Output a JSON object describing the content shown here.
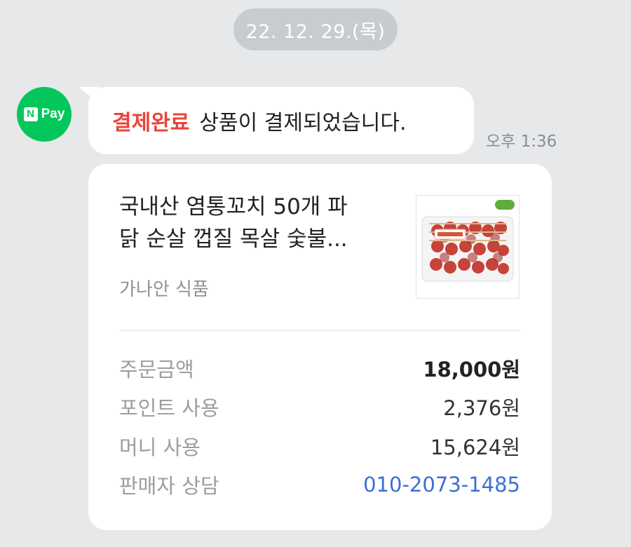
{
  "date_separator": "22. 12. 29.(목)",
  "sender": {
    "avatar_n": "N",
    "avatar_pay": "Pay",
    "icon": "naver-pay-icon"
  },
  "message": {
    "highlight": "결제완료",
    "text": "상품이 결제되었습니다.",
    "time": "오후 1:36"
  },
  "card": {
    "product_title": "국내산 염통꼬치 50개 파\n닭 순살 껍질 목살 숯불...",
    "seller": "가나안 식품",
    "thumbnail_label": "가나안",
    "rows": [
      {
        "label": "주문금액",
        "value": "18,000원"
      },
      {
        "label": "포인트 사용",
        "value": "2,376원"
      },
      {
        "label": "머니 사용",
        "value": "15,624원"
      },
      {
        "label": "판매자 상담",
        "value": "010-2073-1485"
      }
    ]
  },
  "colors": {
    "accent_red": "#e8453c",
    "link_blue": "#3d6fd6",
    "naver_green": "#03c75a"
  }
}
